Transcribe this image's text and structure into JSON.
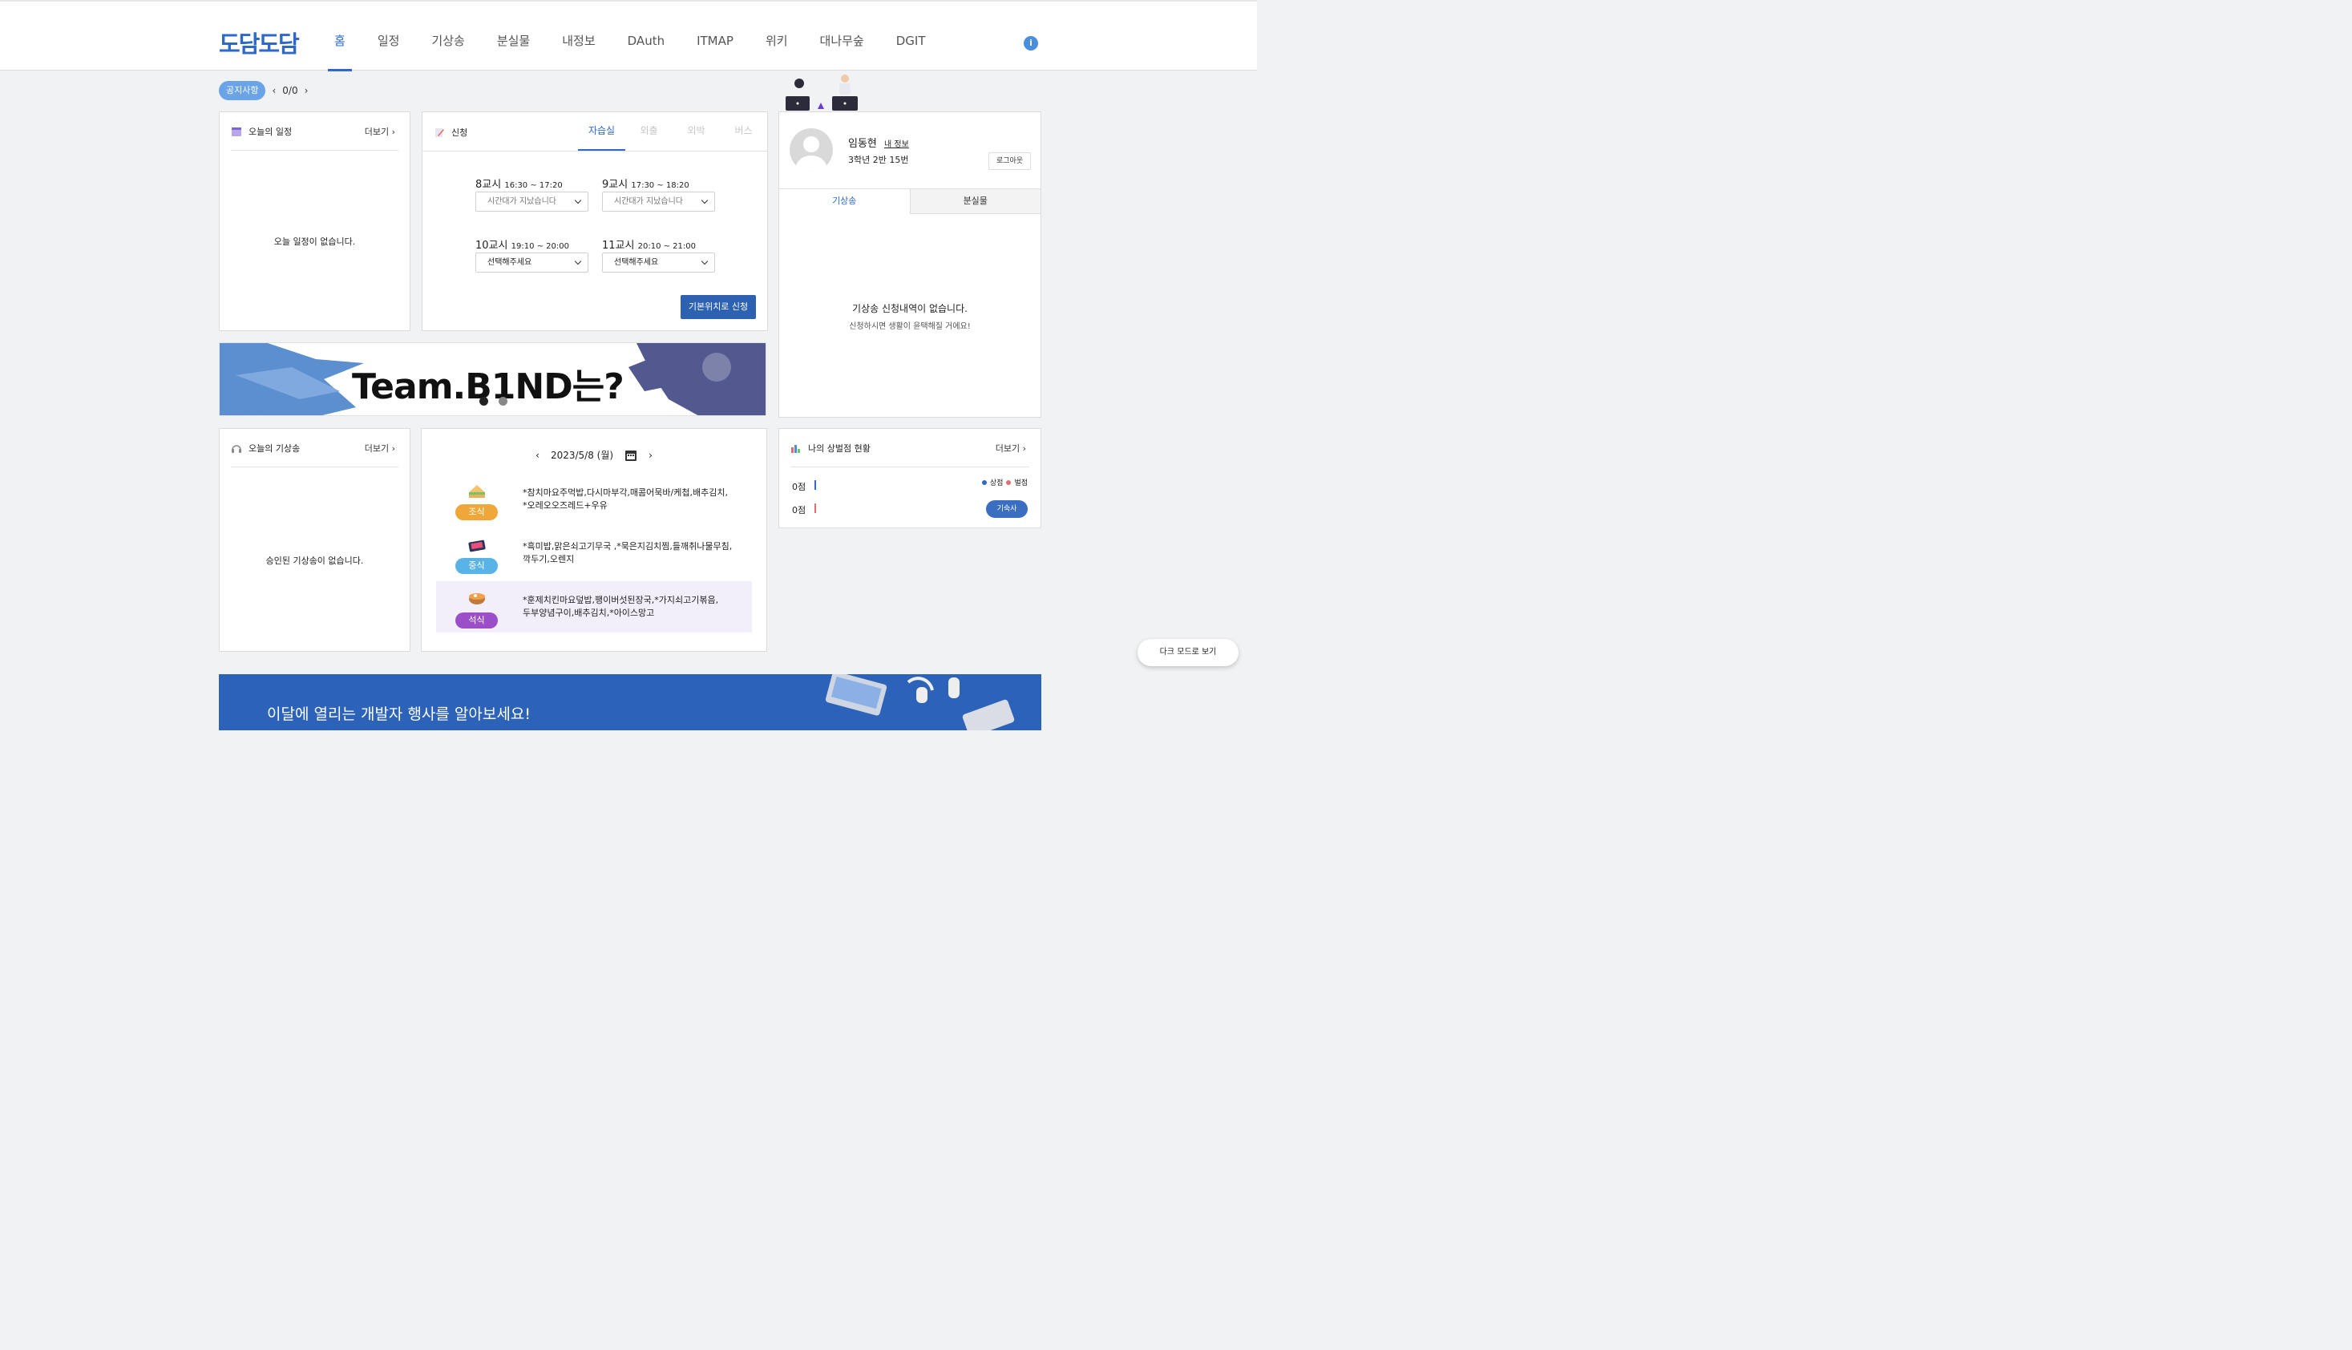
{
  "header": {
    "logo": "도담도담",
    "nav": [
      "홈",
      "일정",
      "기상송",
      "분실물",
      "내정보",
      "DAuth",
      "ITMAP",
      "위키",
      "대나무숲",
      "DGIT"
    ],
    "info_icon": "i"
  },
  "notice": {
    "badge": "공지사항",
    "count": "0/0",
    "prev": "‹",
    "next": "›"
  },
  "schedule": {
    "title": "오늘의 일정",
    "more": "더보기 ›",
    "empty": "오늘 일정이 없습니다."
  },
  "apply": {
    "title": "신청",
    "tabs": [
      "자습실",
      "외출",
      "외박",
      "버스"
    ],
    "periods": [
      {
        "label": "8교시",
        "time": "16:30 ~ 17:20",
        "value": "시간대가 지났습니다"
      },
      {
        "label": "9교시",
        "time": "17:30 ~ 18:20",
        "value": "시간대가 지났습니다"
      },
      {
        "label": "10교시",
        "time": "19:10 ~ 20:00",
        "value": "선택해주세요"
      },
      {
        "label": "11교시",
        "time": "20:10 ~ 21:00",
        "value": "선택해주세요"
      }
    ],
    "button": "기본위치로 신청"
  },
  "banner": {
    "text": "Team.B1ND는?"
  },
  "profile": {
    "name": "임동현",
    "link": "내 정보",
    "class": "3학년 2반 15번",
    "logout": "로그아웃",
    "tabs": [
      "기상송",
      "분실물"
    ],
    "empty_title": "기상송 신청내역이 없습니다.",
    "empty_sub": "신청하시면 생활이 윤택해질 거에요!"
  },
  "wakeup": {
    "title": "오늘의 기상송",
    "more": "더보기 ›",
    "empty": "승인된 기상송이 없습니다."
  },
  "meal": {
    "date": "2023/5/8 (월)",
    "prev": "‹",
    "next": "›",
    "items": [
      {
        "badge": "조식",
        "color": "#f0a73a",
        "text": "*참치마요주먹밥,다시마부각,매콤어묵바/케첩,배추김치,\n*오레오오즈레드+우유"
      },
      {
        "badge": "중식",
        "color": "#59b3e6",
        "text": "*흑미밥,맑은쇠고기무국 ,*묵은지김치찜,들깨취나물무침,\n깍두기,오렌지"
      },
      {
        "badge": "석식",
        "color": "#9a4fc9",
        "text": "*훈제치킨마요덮밥,팽이버섯된장국,*가지쇠고기볶음,\n두부양념구이,배추김치,*아이스망고"
      }
    ]
  },
  "points": {
    "title": "나의 상벌점 현황",
    "more": "더보기 ›",
    "merit_label": "상점",
    "demerit_label": "벌점",
    "merit_value": "0점",
    "demerit_value": "0점",
    "button": "기숙사",
    "merit_color": "#2e69c8",
    "demerit_color": "#e07070"
  },
  "darkmode": "다크 모드로 보기",
  "bottom_banner": "이달에 열리는 개발자 행사를 알아보세요!"
}
